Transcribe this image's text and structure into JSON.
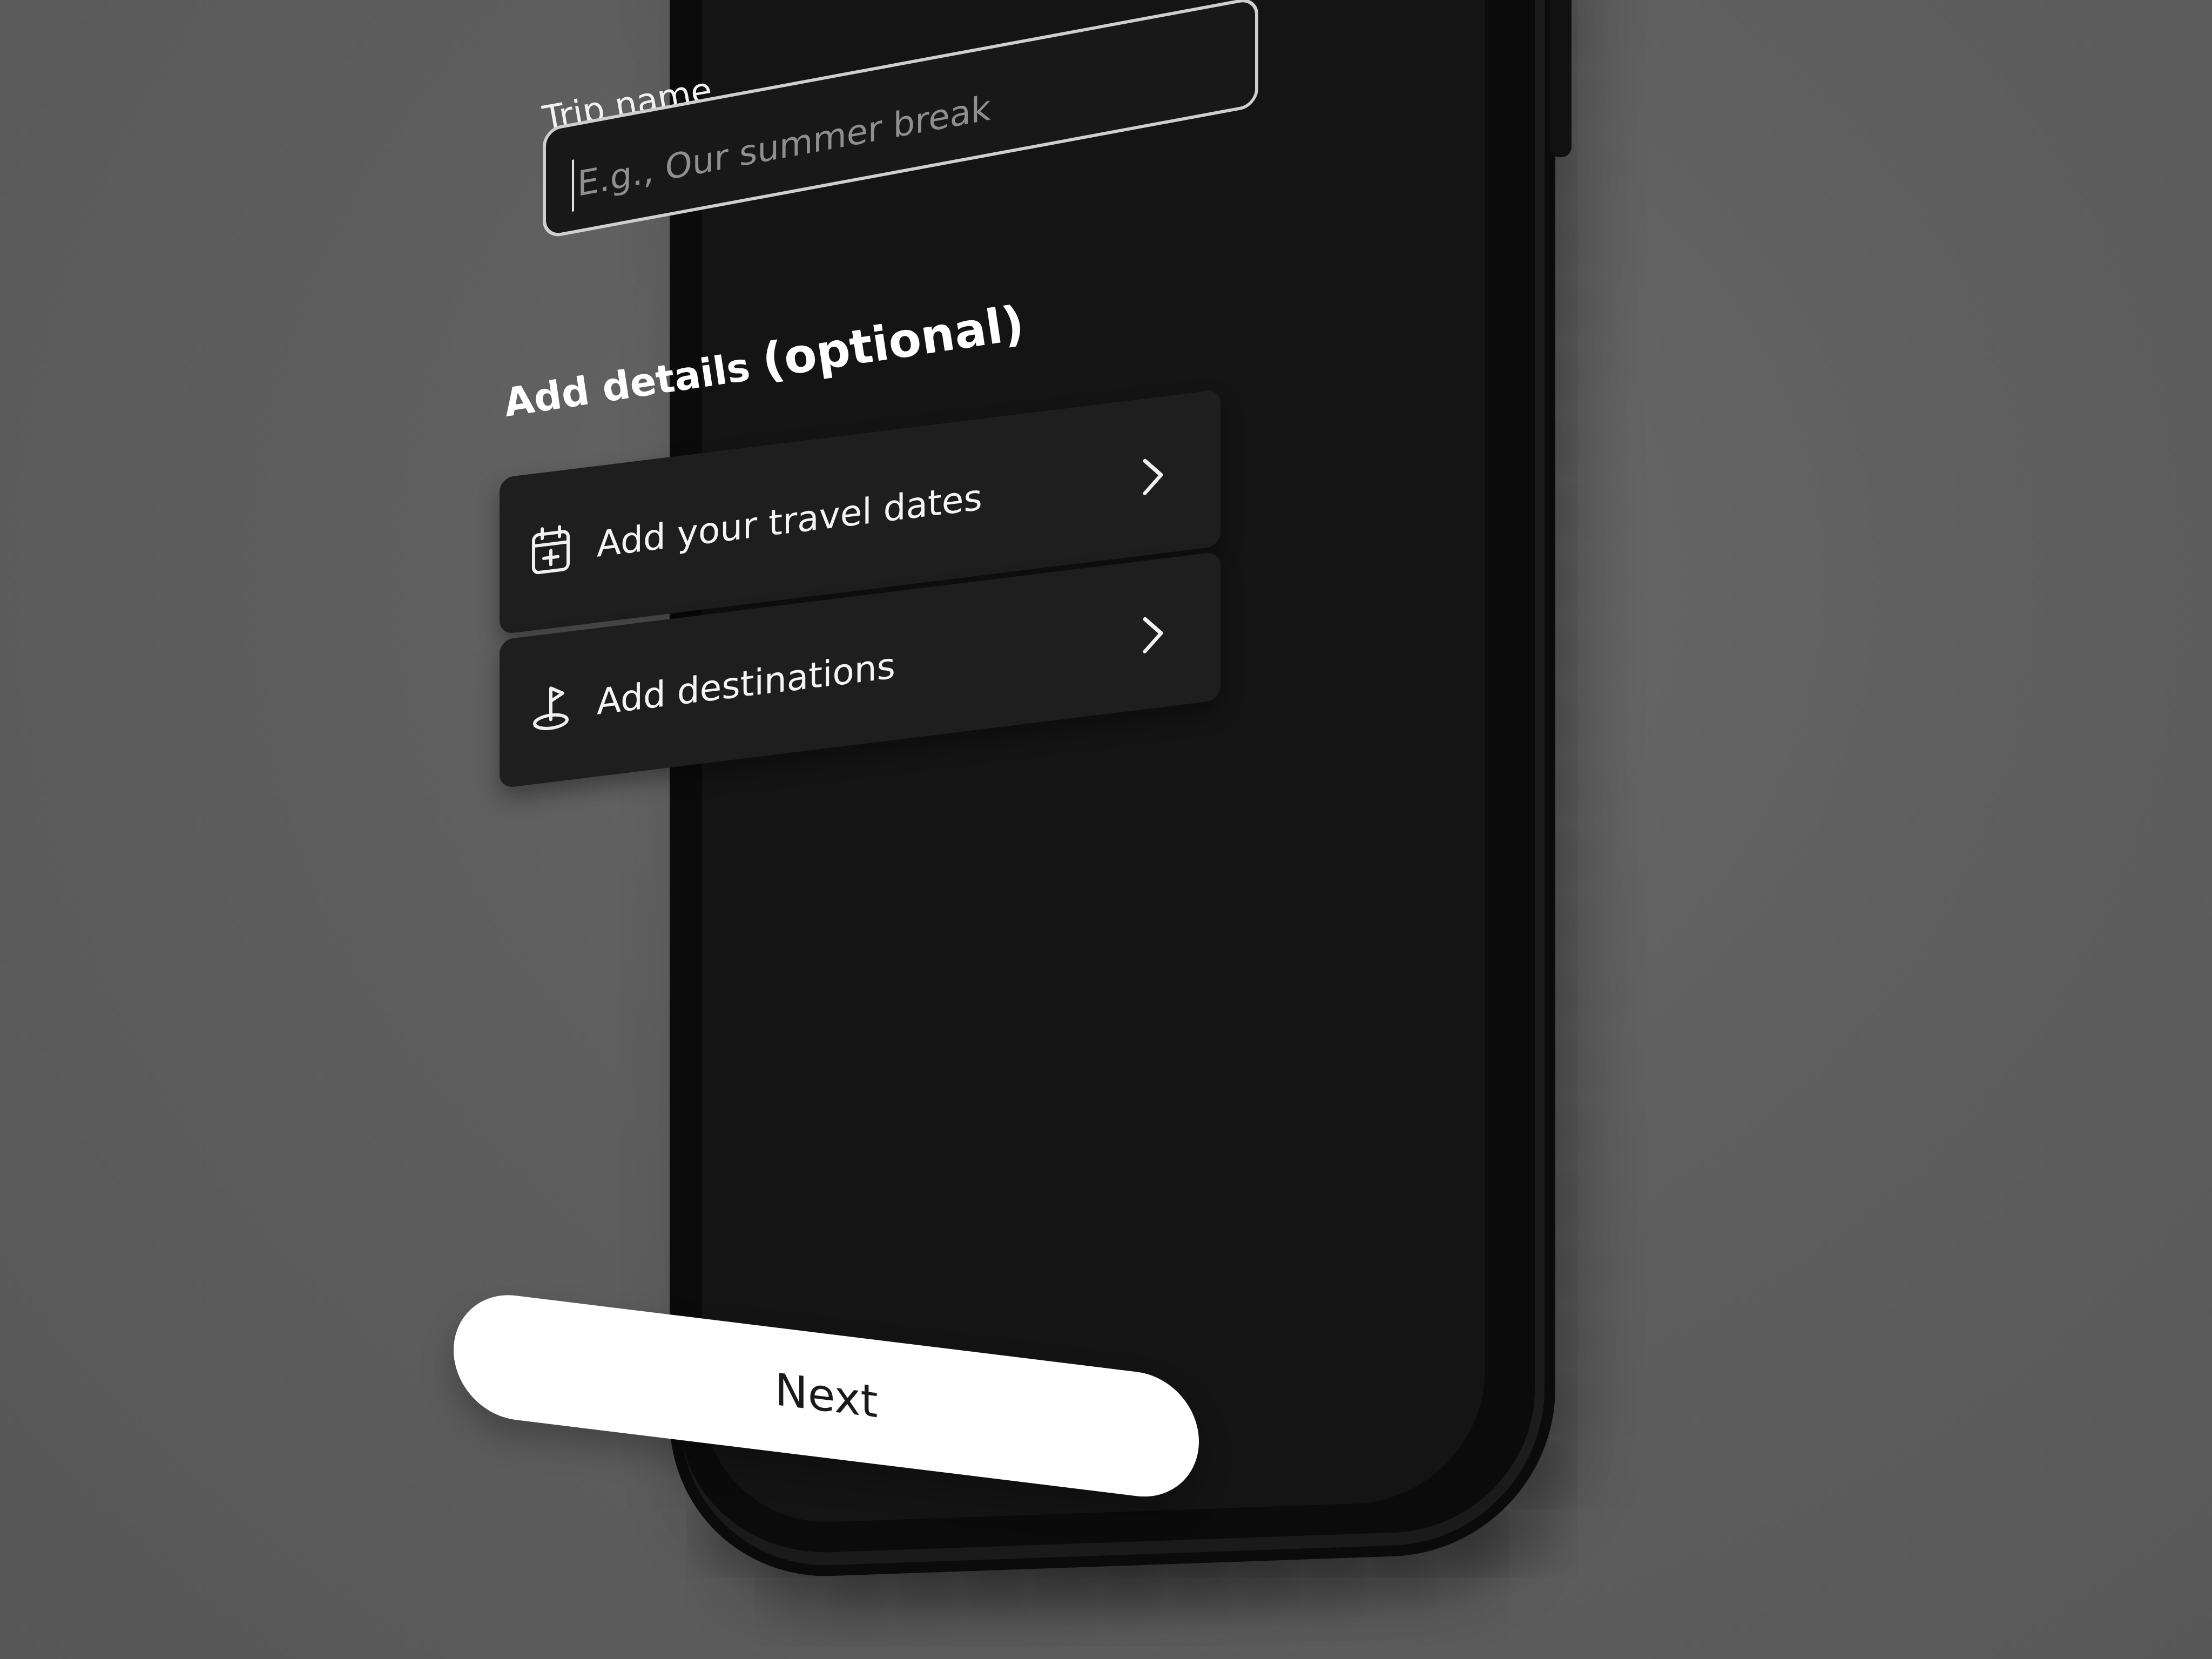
{
  "form": {
    "trip_name_label": "Trip name",
    "trip_name_placeholder": "E.g.,  Our summer break",
    "details_heading": "Add details",
    "details_heading_optional": "(optional)"
  },
  "options": [
    {
      "label": "Add your travel dates",
      "icon": "calendar-plus-icon"
    },
    {
      "label": "Add destinations",
      "icon": "map-pin-icon"
    }
  ],
  "actions": {
    "next_label": "Next"
  },
  "colors": {
    "background": "#5e5e5e",
    "screen": "#141414",
    "card": "#1e1e1e",
    "button": "#ffffff",
    "text_primary": "#ffffff",
    "placeholder": "#8f8f8f"
  }
}
